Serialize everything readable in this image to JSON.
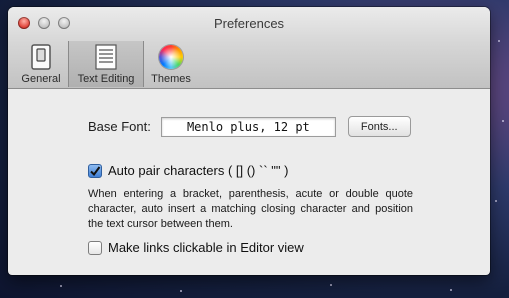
{
  "window": {
    "title": "Preferences"
  },
  "toolbar": {
    "items": [
      {
        "label": "General",
        "icon": "switch-icon",
        "selected": false
      },
      {
        "label": "Text Editing",
        "icon": "document-lines-icon",
        "selected": true
      },
      {
        "label": "Themes",
        "icon": "color-wheel-icon",
        "selected": false
      }
    ]
  },
  "base_font": {
    "label": "Base Font:",
    "value": "Menlo plus, 12 pt",
    "button_label": "Fonts..."
  },
  "auto_pair": {
    "label": "Auto pair characters ( [] () `` \"\" )",
    "checked": true,
    "description": "When entering a bracket, parenthesis, acute or double quote character, auto insert a matching closing character and position the text cursor between them."
  },
  "links": {
    "label": "Make links clickable in Editor view",
    "checked": false
  },
  "colors": {
    "checkbox_accent": "#3f7fd6",
    "close_button": "#e0443a"
  }
}
